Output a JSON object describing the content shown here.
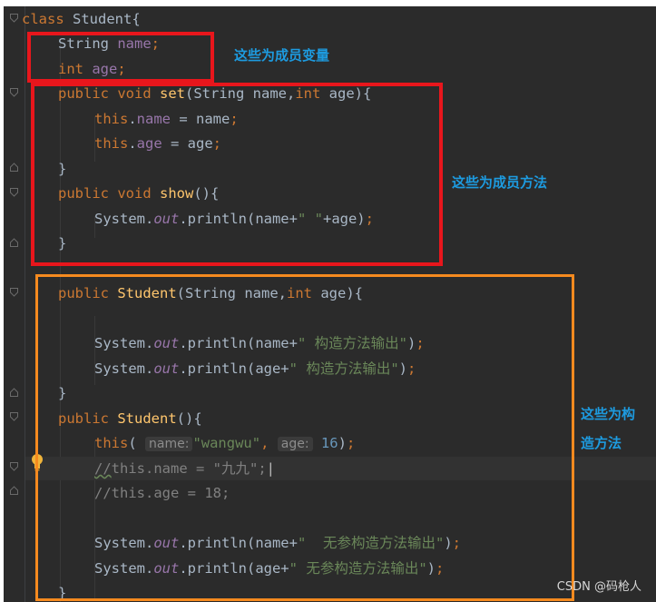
{
  "code": {
    "l1": {
      "kw": "class",
      "rest": " Student{"
    },
    "l2": {
      "type": "String",
      "name": "name",
      "semi": ";"
    },
    "l3": {
      "kw": "int",
      "name": "age",
      "semi": ";"
    },
    "l4": {
      "kw1": "public",
      "kw2": "void",
      "fn": "set",
      "p1": "(String name,",
      "kw3": "int",
      "p2": " age){"
    },
    "l5": {
      "kw": "this",
      "dot": ".",
      "field": "name",
      "rest": " = name",
      "semi": ";"
    },
    "l6": {
      "kw": "this",
      "dot": ".",
      "field": "age",
      "rest": " = age",
      "semi": ";"
    },
    "l7": {
      "text": "}"
    },
    "l8": {
      "kw1": "public",
      "kw2": "void",
      "fn": "show",
      "rest": "(){"
    },
    "l9": {
      "a": "System.",
      "static": "out",
      "b": ".println(name+",
      "str": "\" \"",
      "c": "+age)",
      "semi": ";"
    },
    "l10": {
      "text": "}"
    },
    "l11": {
      "kw": "public",
      "fn": "Student",
      "p1": "(String name,",
      "kw2": "int",
      "p2": " age){"
    },
    "l12": {
      "a": "System.",
      "static": "out",
      "b": ".println(name+",
      "str": "\" 构造方法输出\"",
      "c": ")",
      "semi": ";"
    },
    "l13": {
      "a": "System.",
      "static": "out",
      "b": ".println(age+",
      "str": "\" 构造方法输出\"",
      "c": ")",
      "semi": ";"
    },
    "l14": {
      "text": "}"
    },
    "l15": {
      "kw": "public",
      "fn": "Student",
      "rest": "(){"
    },
    "l16": {
      "kw": "this",
      "open": "(",
      "hint1": "name:",
      "str": "\"wangwu\"",
      "comma": ",",
      "hint2": "age:",
      "num": "16",
      "close": ")",
      "semi": ";"
    },
    "l17": {
      "slashes": "//",
      "rest": "this.name = \"九九\";"
    },
    "l18": {
      "text": "//this.age = 18;"
    },
    "l19": {
      "a": "System.",
      "static": "out",
      "b": ".println(name+",
      "str": "\"  无参构造方法输出\"",
      "c": ")",
      "semi": ";"
    },
    "l20": {
      "a": "System.",
      "static": "out",
      "b": ".println(age+",
      "str": "\" 无参构造方法输出\"",
      "c": ")",
      "semi": ";"
    },
    "l21": {
      "text": "}"
    }
  },
  "annotations": {
    "member_variables": "这些为成员变量",
    "member_methods": "这些为成员方法",
    "constructors_line1": "这些为构",
    "constructors_line2": "造方法"
  },
  "watermark": "CSDN @码枪人",
  "colors": {
    "editor_bg": "#2b2b2b",
    "keyword": "#cc7832",
    "field": "#9876aa",
    "method": "#ffc66d",
    "string": "#6a8759",
    "number": "#6897bb",
    "red_box": "#e8161c",
    "orange_box": "#f58a1f",
    "annotation_text": "#1d9be0"
  }
}
